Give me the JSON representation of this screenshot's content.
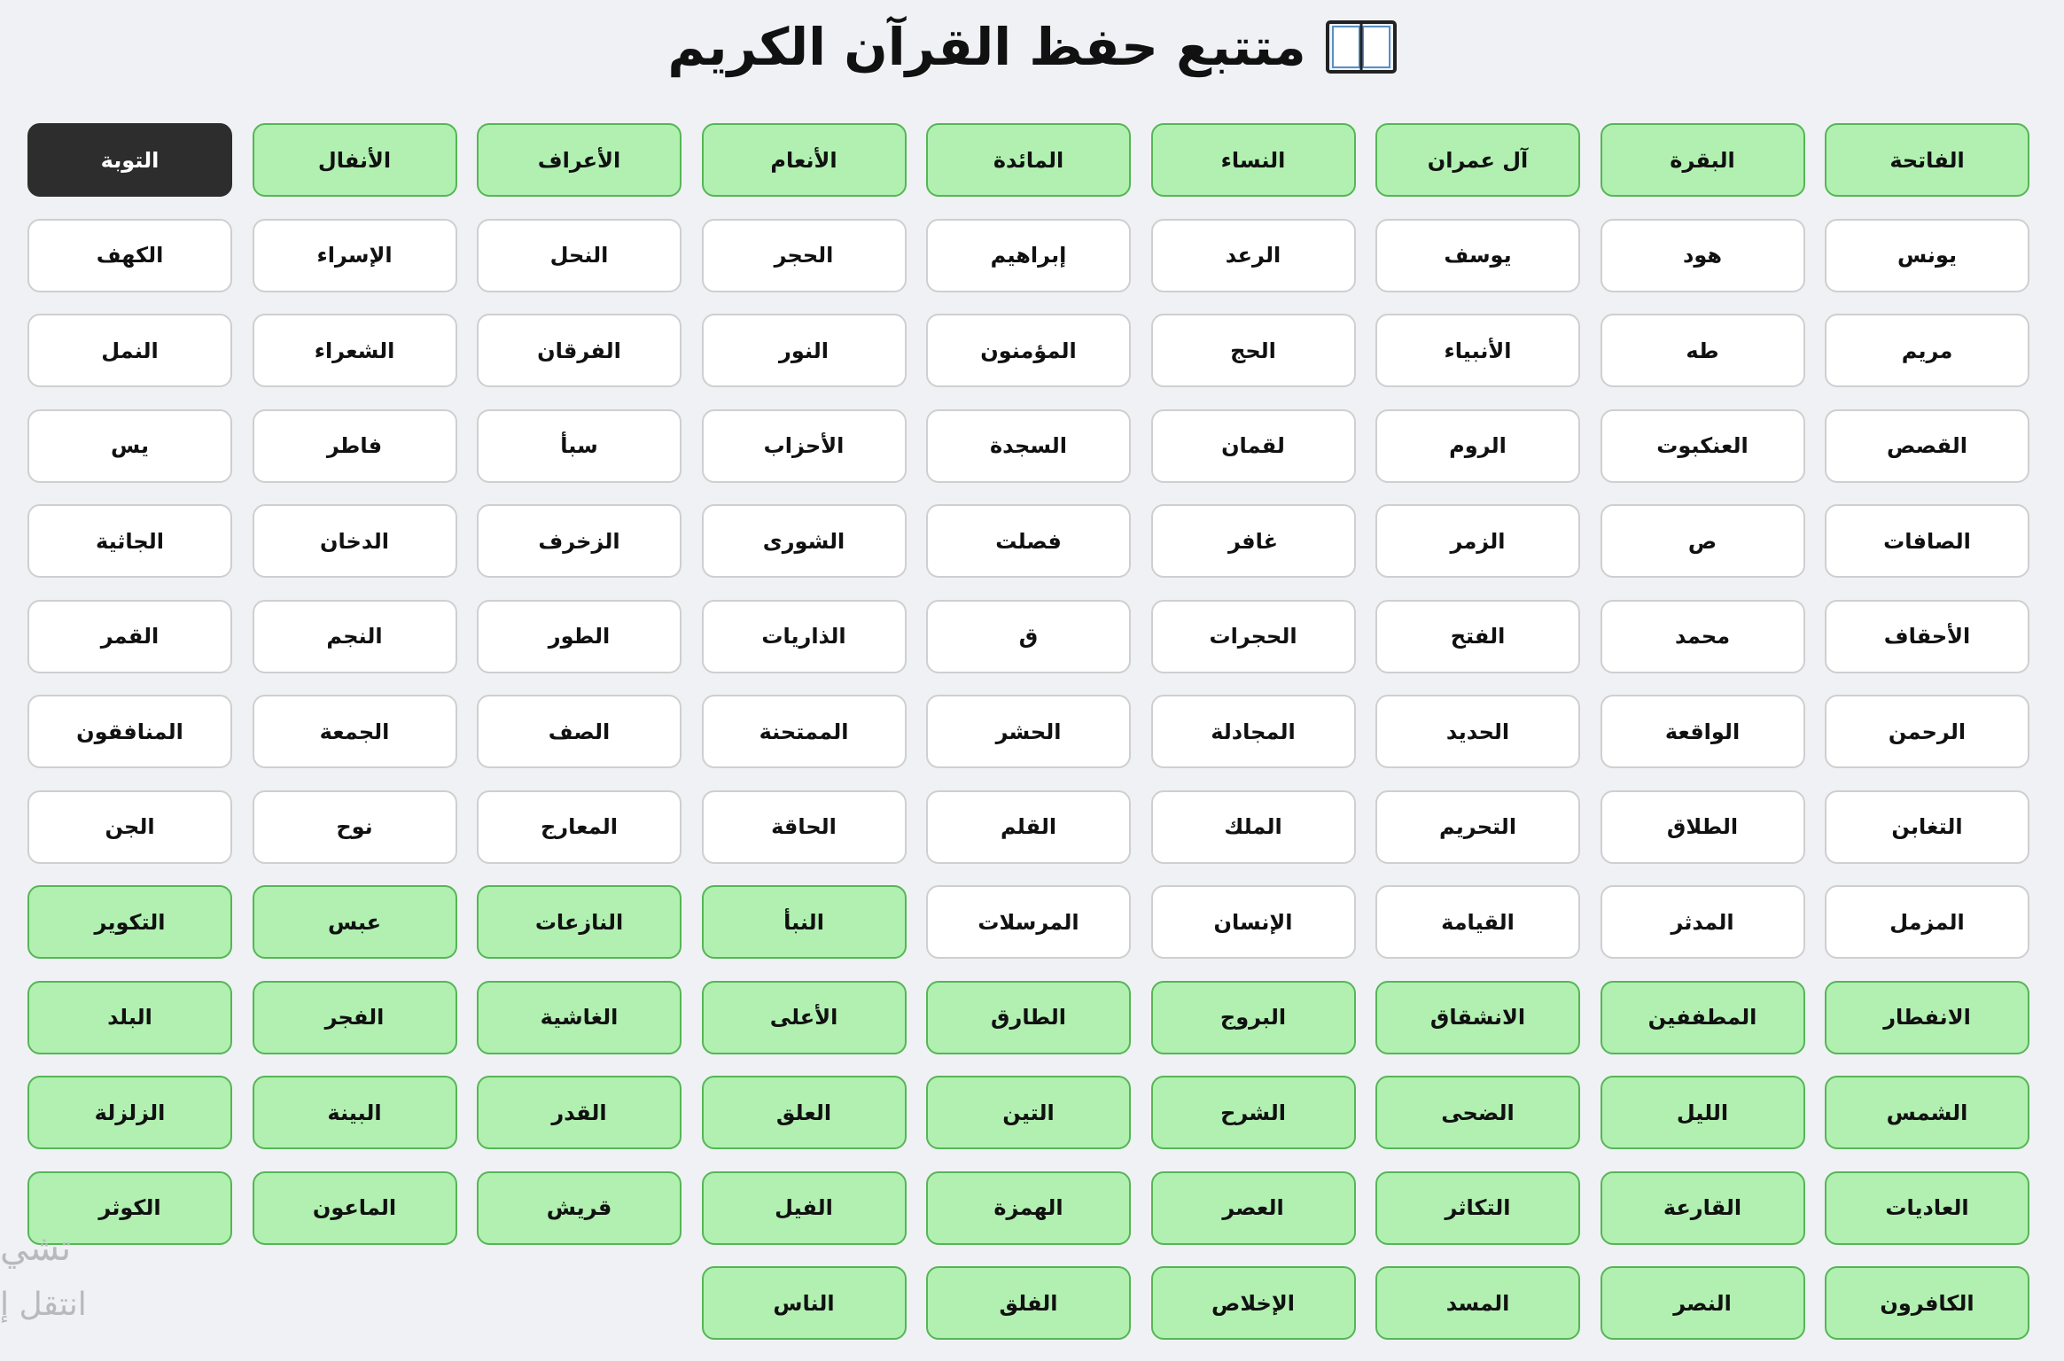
{
  "header": {
    "title": "متتبع حفظ القرآن الكريم",
    "icon": "open-book-icon"
  },
  "colors": {
    "memorized": "#b1f0b1",
    "memorized_border": "#55b655",
    "current": "#2d2d2d",
    "default": "#ffffff",
    "background": "#f0f1f5"
  },
  "surahs": [
    {
      "name": "الفاتحة",
      "status": "memorized"
    },
    {
      "name": "البقرة",
      "status": "memorized"
    },
    {
      "name": "آل عمران",
      "status": "memorized"
    },
    {
      "name": "النساء",
      "status": "memorized"
    },
    {
      "name": "المائدة",
      "status": "memorized"
    },
    {
      "name": "الأنعام",
      "status": "memorized"
    },
    {
      "name": "الأعراف",
      "status": "memorized"
    },
    {
      "name": "الأنفال",
      "status": "memorized"
    },
    {
      "name": "التوبة",
      "status": "current"
    },
    {
      "name": "يونس",
      "status": "none"
    },
    {
      "name": "هود",
      "status": "none"
    },
    {
      "name": "يوسف",
      "status": "none"
    },
    {
      "name": "الرعد",
      "status": "none"
    },
    {
      "name": "إبراهيم",
      "status": "none"
    },
    {
      "name": "الحجر",
      "status": "none"
    },
    {
      "name": "النحل",
      "status": "none"
    },
    {
      "name": "الإسراء",
      "status": "none"
    },
    {
      "name": "الكهف",
      "status": "none"
    },
    {
      "name": "مريم",
      "status": "none"
    },
    {
      "name": "طه",
      "status": "none"
    },
    {
      "name": "الأنبياء",
      "status": "none"
    },
    {
      "name": "الحج",
      "status": "none"
    },
    {
      "name": "المؤمنون",
      "status": "none"
    },
    {
      "name": "النور",
      "status": "none"
    },
    {
      "name": "الفرقان",
      "status": "none"
    },
    {
      "name": "الشعراء",
      "status": "none"
    },
    {
      "name": "النمل",
      "status": "none"
    },
    {
      "name": "القصص",
      "status": "none"
    },
    {
      "name": "العنكبوت",
      "status": "none"
    },
    {
      "name": "الروم",
      "status": "none"
    },
    {
      "name": "لقمان",
      "status": "none"
    },
    {
      "name": "السجدة",
      "status": "none"
    },
    {
      "name": "الأحزاب",
      "status": "none"
    },
    {
      "name": "سبأ",
      "status": "none"
    },
    {
      "name": "فاطر",
      "status": "none"
    },
    {
      "name": "يس",
      "status": "none"
    },
    {
      "name": "الصافات",
      "status": "none"
    },
    {
      "name": "ص",
      "status": "none"
    },
    {
      "name": "الزمر",
      "status": "none"
    },
    {
      "name": "غافر",
      "status": "none"
    },
    {
      "name": "فصلت",
      "status": "none"
    },
    {
      "name": "الشورى",
      "status": "none"
    },
    {
      "name": "الزخرف",
      "status": "none"
    },
    {
      "name": "الدخان",
      "status": "none"
    },
    {
      "name": "الجاثية",
      "status": "none"
    },
    {
      "name": "الأحقاف",
      "status": "none"
    },
    {
      "name": "محمد",
      "status": "none"
    },
    {
      "name": "الفتح",
      "status": "none"
    },
    {
      "name": "الحجرات",
      "status": "none"
    },
    {
      "name": "ق",
      "status": "none"
    },
    {
      "name": "الذاريات",
      "status": "none"
    },
    {
      "name": "الطور",
      "status": "none"
    },
    {
      "name": "النجم",
      "status": "none"
    },
    {
      "name": "القمر",
      "status": "none"
    },
    {
      "name": "الرحمن",
      "status": "none"
    },
    {
      "name": "الواقعة",
      "status": "none"
    },
    {
      "name": "الحديد",
      "status": "none"
    },
    {
      "name": "المجادلة",
      "status": "none"
    },
    {
      "name": "الحشر",
      "status": "none"
    },
    {
      "name": "الممتحنة",
      "status": "none"
    },
    {
      "name": "الصف",
      "status": "none"
    },
    {
      "name": "الجمعة",
      "status": "none"
    },
    {
      "name": "المنافقون",
      "status": "none"
    },
    {
      "name": "التغابن",
      "status": "none"
    },
    {
      "name": "الطلاق",
      "status": "none"
    },
    {
      "name": "التحريم",
      "status": "none"
    },
    {
      "name": "الملك",
      "status": "none"
    },
    {
      "name": "القلم",
      "status": "none"
    },
    {
      "name": "الحاقة",
      "status": "none"
    },
    {
      "name": "المعارج",
      "status": "none"
    },
    {
      "name": "نوح",
      "status": "none"
    },
    {
      "name": "الجن",
      "status": "none"
    },
    {
      "name": "المزمل",
      "status": "none"
    },
    {
      "name": "المدثر",
      "status": "none"
    },
    {
      "name": "القيامة",
      "status": "none"
    },
    {
      "name": "الإنسان",
      "status": "none"
    },
    {
      "name": "المرسلات",
      "status": "none"
    },
    {
      "name": "النبأ",
      "status": "memorized"
    },
    {
      "name": "النازعات",
      "status": "memorized"
    },
    {
      "name": "عبس",
      "status": "memorized"
    },
    {
      "name": "التكوير",
      "status": "memorized"
    },
    {
      "name": "الانفطار",
      "status": "memorized"
    },
    {
      "name": "المطففين",
      "status": "memorized"
    },
    {
      "name": "الانشقاق",
      "status": "memorized"
    },
    {
      "name": "البروج",
      "status": "memorized"
    },
    {
      "name": "الطارق",
      "status": "memorized"
    },
    {
      "name": "الأعلى",
      "status": "memorized"
    },
    {
      "name": "الغاشية",
      "status": "memorized"
    },
    {
      "name": "الفجر",
      "status": "memorized"
    },
    {
      "name": "البلد",
      "status": "memorized"
    },
    {
      "name": "الشمس",
      "status": "memorized"
    },
    {
      "name": "الليل",
      "status": "memorized"
    },
    {
      "name": "الضحى",
      "status": "memorized"
    },
    {
      "name": "الشرح",
      "status": "memorized"
    },
    {
      "name": "التين",
      "status": "memorized"
    },
    {
      "name": "العلق",
      "status": "memorized"
    },
    {
      "name": "القدر",
      "status": "memorized"
    },
    {
      "name": "البينة",
      "status": "memorized"
    },
    {
      "name": "الزلزلة",
      "status": "memorized"
    },
    {
      "name": "العاديات",
      "status": "memorized"
    },
    {
      "name": "القارعة",
      "status": "memorized"
    },
    {
      "name": "التكاثر",
      "status": "memorized"
    },
    {
      "name": "العصر",
      "status": "memorized"
    },
    {
      "name": "الهمزة",
      "status": "memorized"
    },
    {
      "name": "الفيل",
      "status": "memorized"
    },
    {
      "name": "قريش",
      "status": "memorized"
    },
    {
      "name": "الماعون",
      "status": "memorized"
    },
    {
      "name": "الكوثر",
      "status": "memorized"
    },
    {
      "name": "الكافرون",
      "status": "memorized"
    },
    {
      "name": "النصر",
      "status": "memorized"
    },
    {
      "name": "المسد",
      "status": "memorized"
    },
    {
      "name": "الإخلاص",
      "status": "memorized"
    },
    {
      "name": "الفلق",
      "status": "memorized"
    },
    {
      "name": "الناس",
      "status": "memorized"
    }
  ],
  "side_notes": {
    "line1": "تشي",
    "line2": "انتقل إ"
  }
}
